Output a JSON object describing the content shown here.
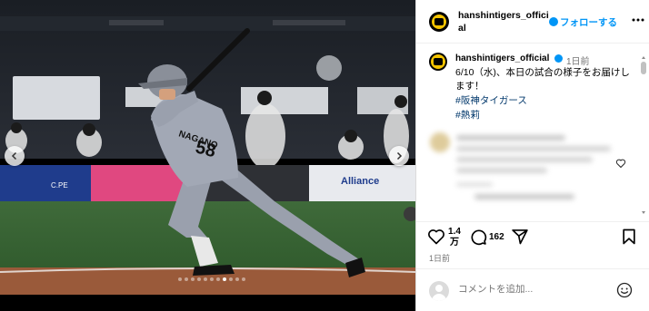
{
  "header": {
    "username": "hanshintigers_official",
    "follow_label": "フォローする"
  },
  "caption": {
    "username": "hanshintigers_official",
    "time": "1日前",
    "text": "6/10（水)、本日の試合の様子をお届けします！",
    "hashtags": [
      "#阪神タイガース",
      "#熱莉"
    ]
  },
  "player": {
    "name_on_jersey": "NAGANO",
    "number": "58"
  },
  "actions": {
    "like_count_top": "1.4",
    "like_count_bottom": "万",
    "comment_count": "162",
    "date": "1日前"
  },
  "add_comment": {
    "placeholder": "コメントを追加..."
  },
  "colors": {
    "accent": "#0095f6",
    "hashtag": "#00376b"
  }
}
